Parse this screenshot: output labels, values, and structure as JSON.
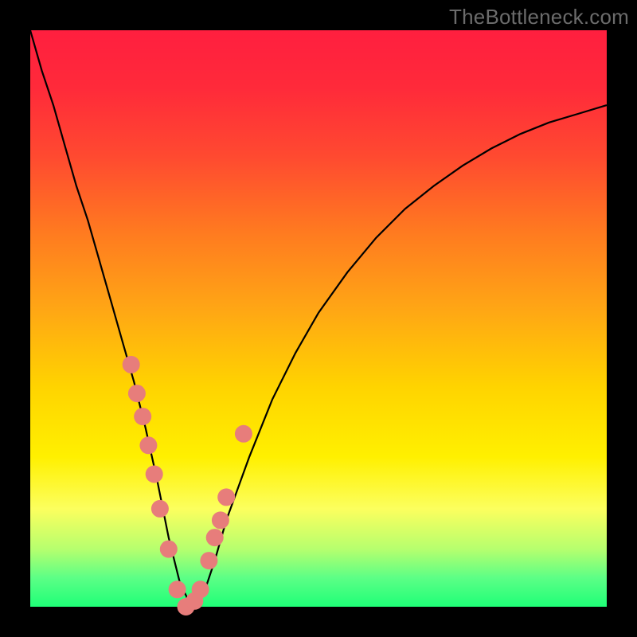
{
  "watermark": "TheBottleneck.com",
  "colors": {
    "frame": "#000000",
    "gradient_top": "#ff1f3f",
    "gradient_bottom": "#1fff77",
    "curve": "#000000",
    "marker": "#e77d7b"
  },
  "chart_data": {
    "type": "line",
    "title": "",
    "xlabel": "",
    "ylabel": "",
    "xlim": [
      0,
      100
    ],
    "ylim": [
      0,
      100
    ],
    "curve": {
      "x": [
        0,
        2,
        4,
        6,
        8,
        10,
        12,
        14,
        16,
        18,
        20,
        22,
        24,
        26,
        28,
        30,
        32,
        34,
        38,
        42,
        46,
        50,
        55,
        60,
        65,
        70,
        75,
        80,
        85,
        90,
        95,
        100
      ],
      "y": [
        100,
        93,
        87,
        80,
        73,
        67,
        60,
        53,
        46,
        39,
        31,
        22,
        12,
        4,
        0,
        2,
        8,
        15,
        26,
        36,
        44,
        51,
        58,
        64,
        69,
        73,
        76.5,
        79.5,
        82,
        84,
        85.5,
        87
      ]
    },
    "markers": {
      "x": [
        17.5,
        18.5,
        19.5,
        20.5,
        21.5,
        22.5,
        24.0,
        25.5,
        27.0,
        28.5,
        29.5,
        31.0,
        32.0,
        33.0,
        34.0,
        37.0
      ],
      "y": [
        42,
        37,
        33,
        28,
        23,
        17,
        10,
        3,
        0,
        1,
        3,
        8,
        12,
        15,
        19,
        30
      ]
    },
    "notes": "V-shaped bottleneck curve; minimum near x≈28; background is vertical red→green gradient indicating bottleneck severity"
  }
}
